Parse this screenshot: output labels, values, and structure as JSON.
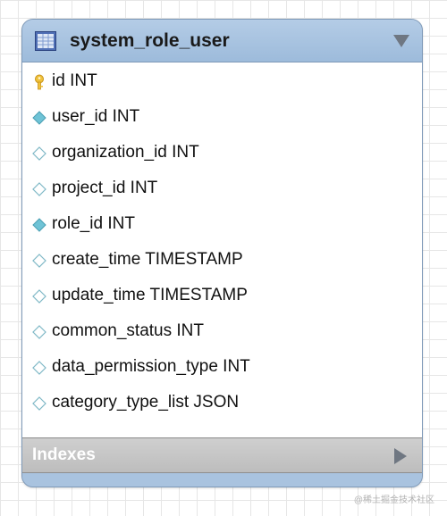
{
  "table": {
    "title": "system_role_user",
    "icon": "table-icon",
    "columns": [
      {
        "label": "id INT",
        "icon": "primary-key-icon"
      },
      {
        "label": "user_id INT",
        "icon": "filled-diamond-icon"
      },
      {
        "label": "organization_id INT",
        "icon": "empty-diamond-icon"
      },
      {
        "label": "project_id INT",
        "icon": "empty-diamond-icon"
      },
      {
        "label": "role_id INT",
        "icon": "filled-diamond-icon"
      },
      {
        "label": "create_time TIMESTAMP",
        "icon": "empty-diamond-icon"
      },
      {
        "label": "update_time TIMESTAMP",
        "icon": "empty-diamond-icon"
      },
      {
        "label": "common_status INT",
        "icon": "empty-diamond-icon"
      },
      {
        "label": "data_permission_type INT",
        "icon": "empty-diamond-icon"
      },
      {
        "label": "category_type_list JSON",
        "icon": "empty-diamond-icon"
      }
    ],
    "indexes_label": "Indexes"
  },
  "watermark": "@稀土掘金技术社区",
  "colors": {
    "header": "#a9c3df",
    "key": "#f0c23c",
    "filled_diamond": "#6fc3d6",
    "indexes_bar": "#c6c6c6"
  }
}
